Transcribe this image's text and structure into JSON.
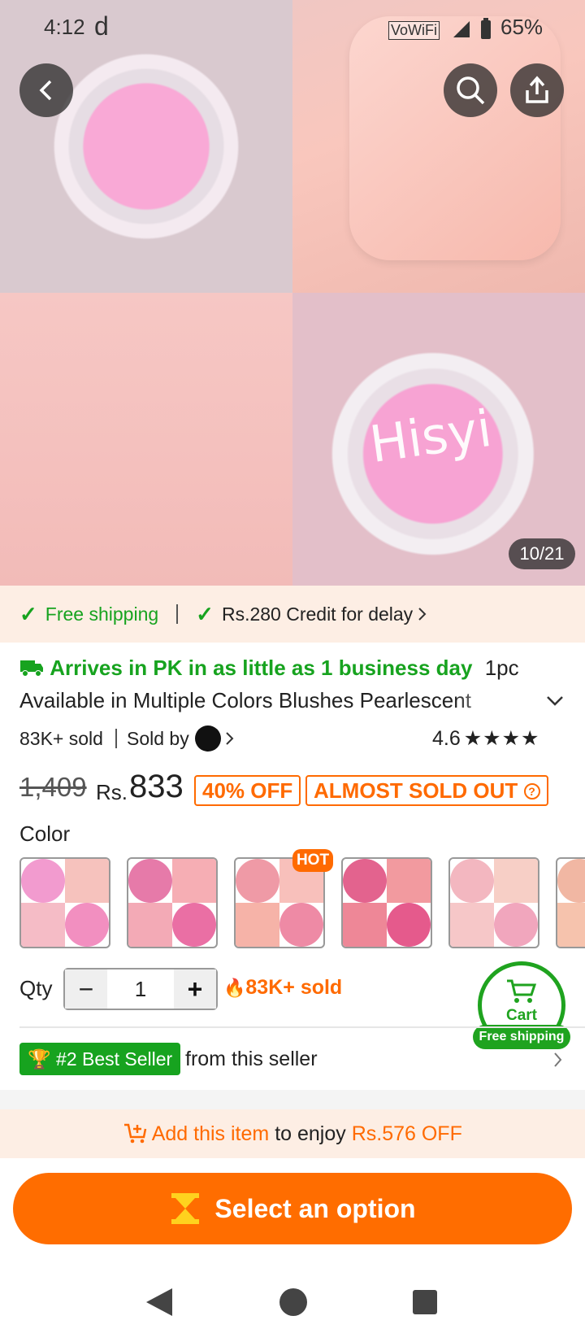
{
  "status_bar": {
    "time": "4:12",
    "notif_glyph": "d",
    "wifi_label": "VoWiFi",
    "battery": "65%"
  },
  "gallery": {
    "counter": "10/21",
    "product_text": "Hisyi"
  },
  "shipping_bar": {
    "free_shipping": "Free shipping",
    "credit": "Rs.280 Credit for delay"
  },
  "product": {
    "arrives": "Arrives in PK in as little as 1 business day",
    "qty_prefix": "1pc",
    "title": "Available in Multiple Colors Blushes Pearlescent",
    "sold": "83K+ sold",
    "sold_by": "Sold by",
    "rating": "4.6",
    "stars": "★★★★",
    "old_price": "1,409",
    "currency": "Rs.",
    "price": "833",
    "discount": "40% OFF",
    "scarcity": "ALMOST SOLD OUT"
  },
  "color_section": {
    "label": "Color",
    "hot_badge": "HOT",
    "swatches": [
      {
        "name": "swatch-1",
        "tl": "#f29bcf",
        "tr": "#f6c2bd",
        "bl": "#f5bcc6",
        "br": "#f28fc0"
      },
      {
        "name": "swatch-2",
        "tl": "#e67aa9",
        "tr": "#f6aeb4",
        "bl": "#f3aab6",
        "br": "#ea6fa4"
      },
      {
        "name": "swatch-3",
        "tl": "#ef9aa6",
        "tr": "#f8c0bb",
        "bl": "#f6b3a8",
        "br": "#ee8aa5"
      },
      {
        "name": "swatch-4",
        "tl": "#e3638e",
        "tr": "#f29a9f",
        "bl": "#ee8797",
        "br": "#e55a8c"
      },
      {
        "name": "swatch-5",
        "tl": "#f3b7c0",
        "tr": "#f7cfc6",
        "bl": "#f6c7c8",
        "br": "#f1a6bd"
      },
      {
        "name": "swatch-6",
        "tl": "#f1b7a3",
        "tr": "#f8d1c1",
        "bl": "#f6c3ad",
        "br": "#f0b09e"
      }
    ]
  },
  "quantity": {
    "label": "Qty",
    "value": "1",
    "minus": "−",
    "plus": "+",
    "sold_hot": "83K+ sold"
  },
  "cart": {
    "label": "Cart",
    "badge": "Free shipping"
  },
  "best_seller": {
    "badge": "#2 Best Seller",
    "text": "from this seller"
  },
  "promo": {
    "link": "Add this item",
    "middle": "to enjoy",
    "amount": "Rs.576 OFF"
  },
  "cta": {
    "label": "Select an option"
  },
  "colors": {
    "accent_orange": "#ff6d00",
    "green": "#17a31f",
    "cream": "#fdeee4"
  }
}
